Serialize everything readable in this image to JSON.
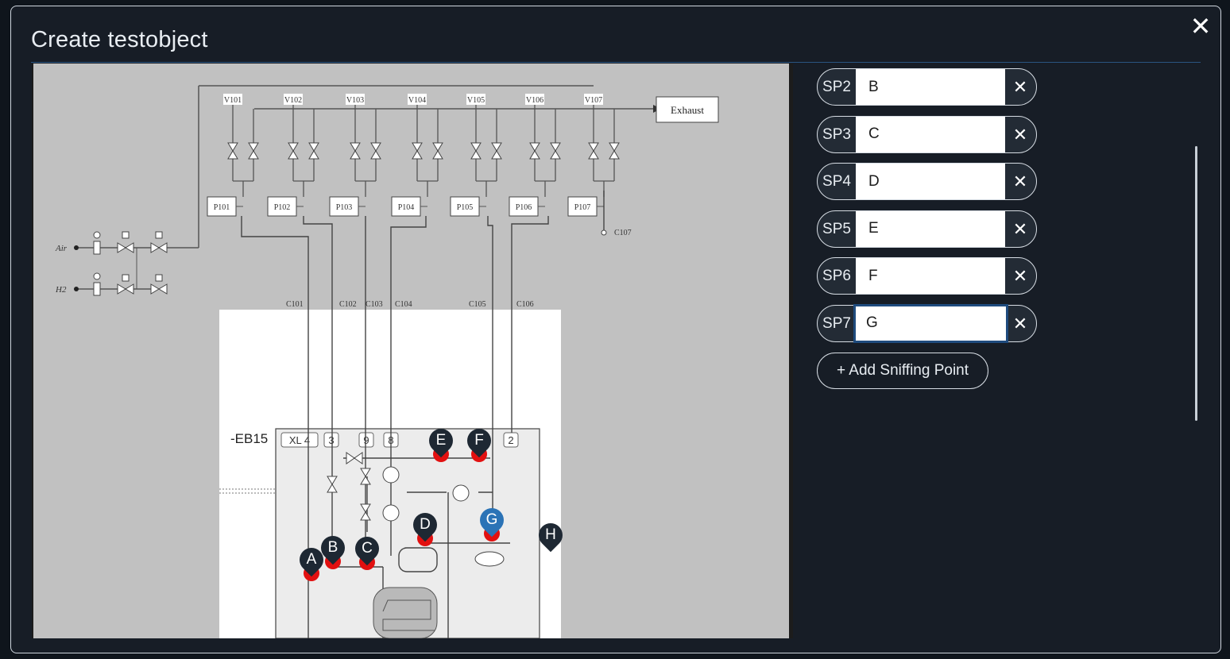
{
  "dialog": {
    "title": "Create testobject",
    "close_label": "✕"
  },
  "diagram": {
    "exhaust_label": "Exhaust",
    "valve_labels": [
      "V101",
      "V102",
      "V103",
      "V104",
      "V105",
      "V106",
      "V107"
    ],
    "pump_labels": [
      "P101",
      "P102",
      "P103",
      "P104",
      "P105",
      "P106",
      "P107"
    ],
    "inlet_labels": [
      "Air",
      "H2"
    ],
    "connection_labels": [
      "C101",
      "C102",
      "C103",
      "C104",
      "C105",
      "C106",
      "C107"
    ],
    "unit_label": "-EB15",
    "port_labels": [
      "XL 4",
      "3",
      "9",
      "8",
      "2"
    ]
  },
  "markers": [
    {
      "label": "A",
      "active": false,
      "has_dot": true
    },
    {
      "label": "B",
      "active": false,
      "has_dot": true
    },
    {
      "label": "C",
      "active": false,
      "has_dot": true
    },
    {
      "label": "D",
      "active": false,
      "has_dot": true
    },
    {
      "label": "E",
      "active": false,
      "has_dot": true
    },
    {
      "label": "F",
      "active": false,
      "has_dot": true
    },
    {
      "label": "G",
      "active": true,
      "has_dot": true
    },
    {
      "label": "H",
      "active": false,
      "has_dot": false
    }
  ],
  "sniffing_points": [
    {
      "tag": "SP2",
      "value": "B"
    },
    {
      "tag": "SP3",
      "value": "C"
    },
    {
      "tag": "SP4",
      "value": "D"
    },
    {
      "tag": "SP5",
      "value": "E"
    },
    {
      "tag": "SP6",
      "value": "F"
    },
    {
      "tag": "SP7",
      "value": "G"
    }
  ],
  "remove_label": "✕",
  "add_button_label": "+ Add Sniffing Point",
  "colors": {
    "background": "#171d26",
    "accent": "#2b73b6",
    "marker_dark": "#1e2833",
    "marker_dot": "#e21010"
  }
}
